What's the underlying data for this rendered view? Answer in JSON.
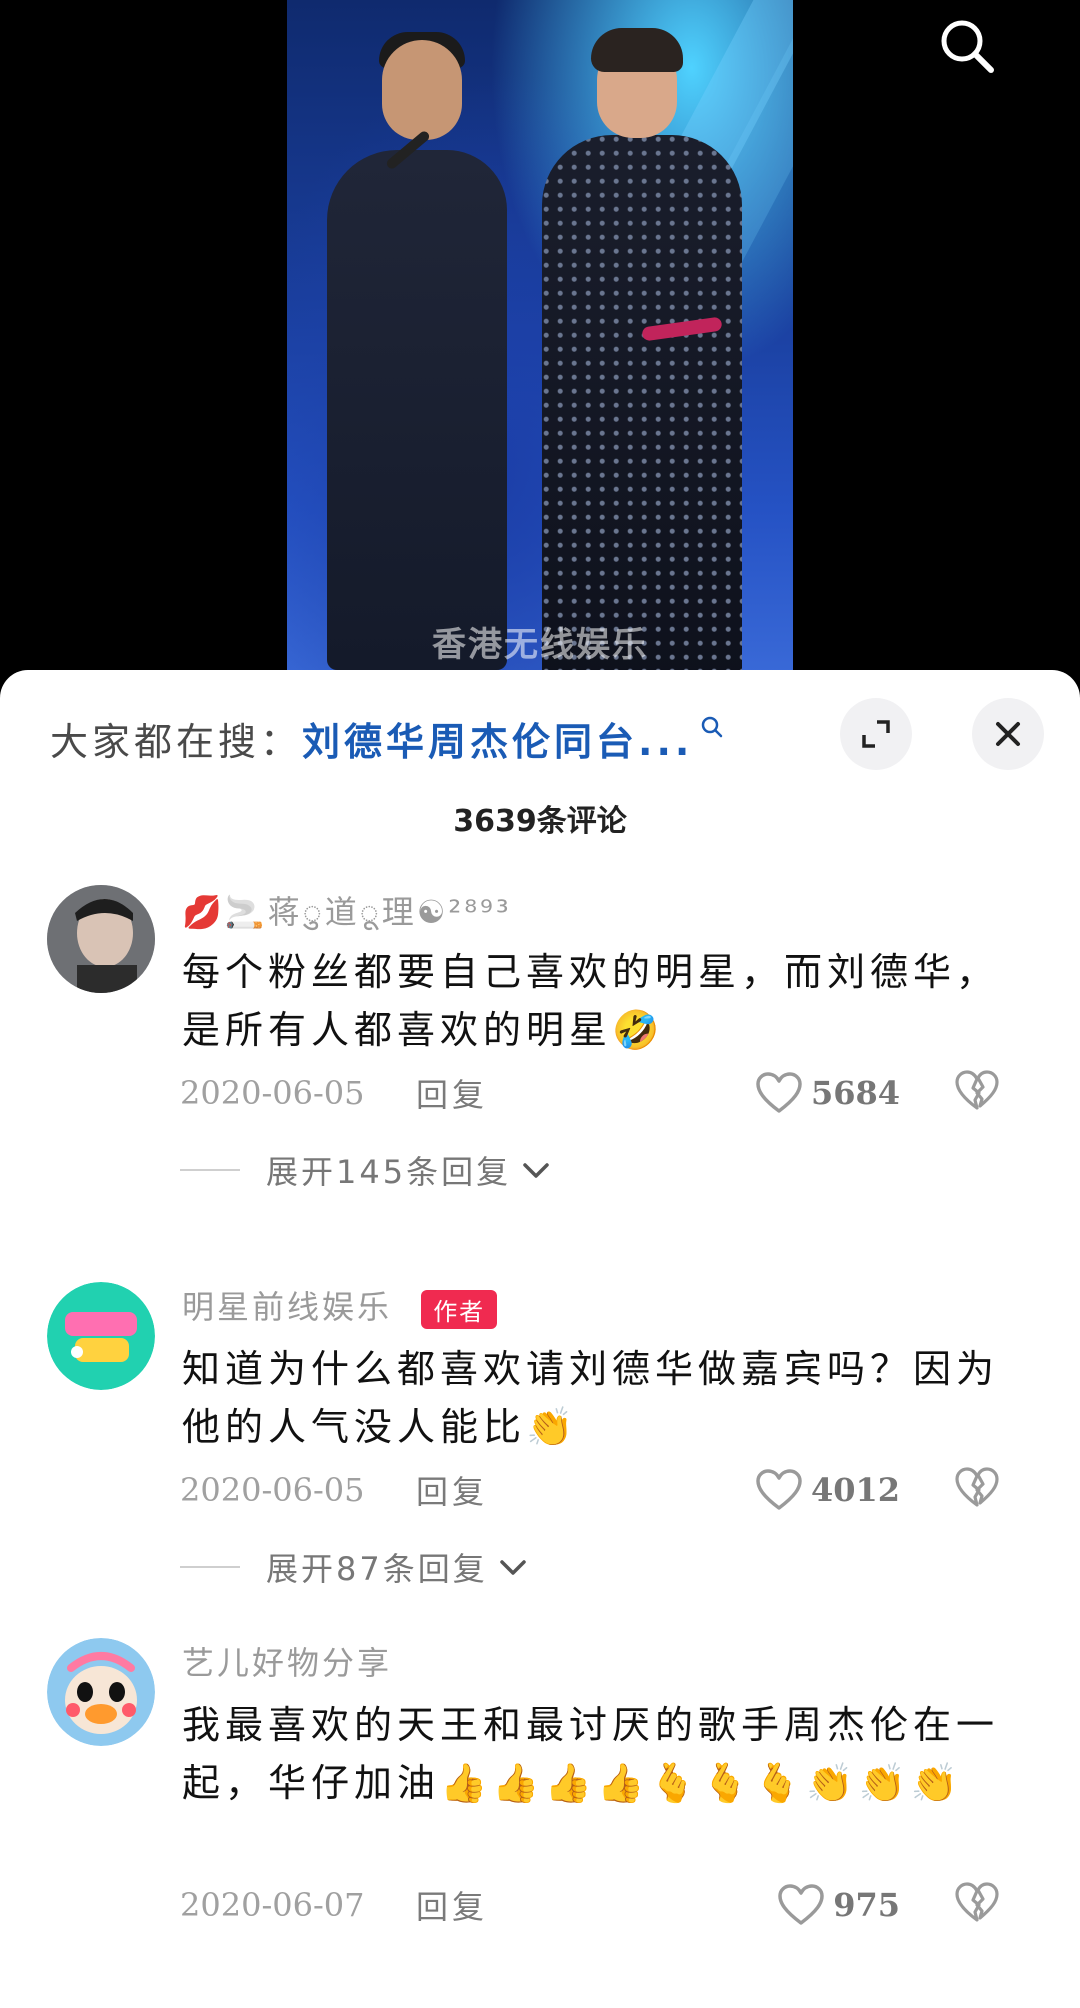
{
  "video": {
    "watermark": "香港无线娱乐"
  },
  "sheet": {
    "search_prefix": "大家都在搜：",
    "search_term": "刘德华周杰伦同台...",
    "comment_count": "3639条评论"
  },
  "comments": [
    {
      "username": "💋🚬蒋ु道ू理☯²⁸⁹³",
      "text": "每个粉丝都要自己喜欢的明星，而刘德华，是所有人都喜欢的明星🤣",
      "date": "2020-06-05",
      "reply_label": "回复",
      "likes": "5684",
      "expand_label": "展开145条回复"
    },
    {
      "username": "明星前线娱乐",
      "badge": "作者",
      "text": "知道为什么都喜欢请刘德华做嘉宾吗？因为他的人气没人能比👏",
      "date": "2020-06-05",
      "reply_label": "回复",
      "likes": "4012",
      "expand_label": "展开87条回复"
    },
    {
      "username": "艺儿好物分享",
      "text": "我最喜欢的天王和最讨厌的歌手周杰伦在一起，华仔加油👍👍👍👍🫰🫰🫰👏👏👏",
      "date": "2020-06-07",
      "reply_label": "回复",
      "likes": "975"
    }
  ]
}
